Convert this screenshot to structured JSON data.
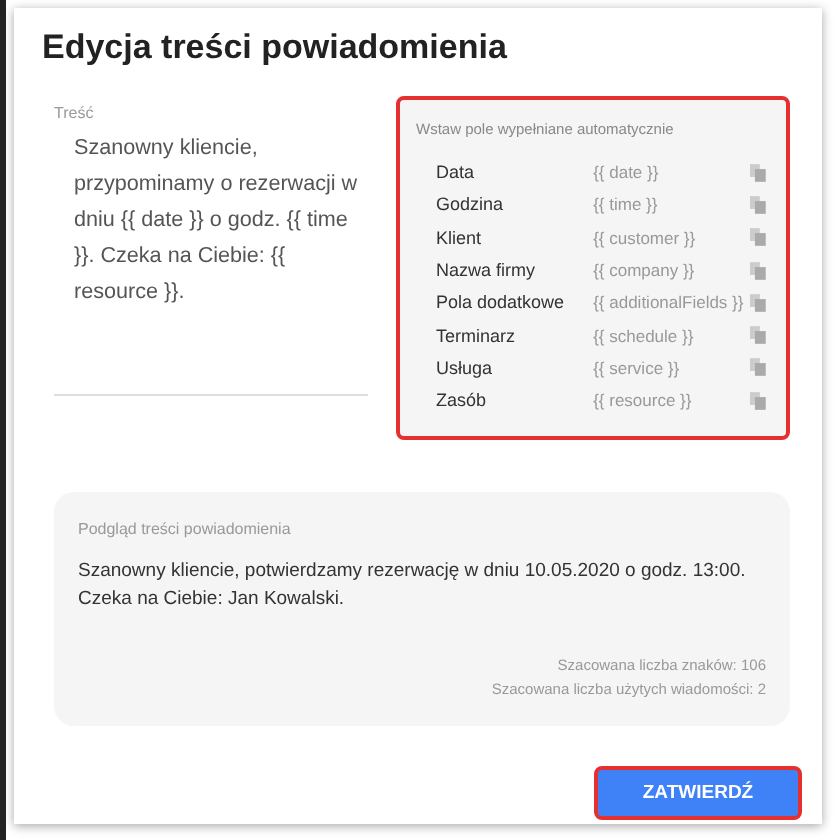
{
  "dialog": {
    "title": "Edycja treści powiadomienia"
  },
  "message": {
    "label": "Treść",
    "value": "Szanowny kliencie, przypominamy o rezerwacji w dniu {{ date }} o godz. {{ time }}. Czeka na Ciebie: {{ resource }}."
  },
  "fields_panel": {
    "title": "Wstaw pole wypełniane automatycznie",
    "fields": [
      {
        "label": "Data",
        "token": "{{ date }}"
      },
      {
        "label": "Godzina",
        "token": "{{ time }}"
      },
      {
        "label": "Klient",
        "token": "{{ customer }}"
      },
      {
        "label": "Nazwa firmy",
        "token": "{{ company }}"
      },
      {
        "label": "Pola dodatkowe",
        "token": "{{ additionalFields }}"
      },
      {
        "label": "Terminarz",
        "token": "{{ schedule }}"
      },
      {
        "label": "Usługa",
        "token": "{{ service }}"
      },
      {
        "label": "Zasób",
        "token": "{{ resource }}"
      }
    ]
  },
  "preview": {
    "title": "Podgląd treści powiadomienia",
    "text": "Szanowny kliencie, potwierdzamy rezerwację w dniu 10.05.2020 o godz. 13:00. Czeka na Ciebie: Jan Kowalski.",
    "char_count": "Szacowana liczba znaków: 106",
    "message_count": "Szacowana liczba użytych wiadomości: 2"
  },
  "buttons": [
    "ZATWIERDŹ"
  ]
}
